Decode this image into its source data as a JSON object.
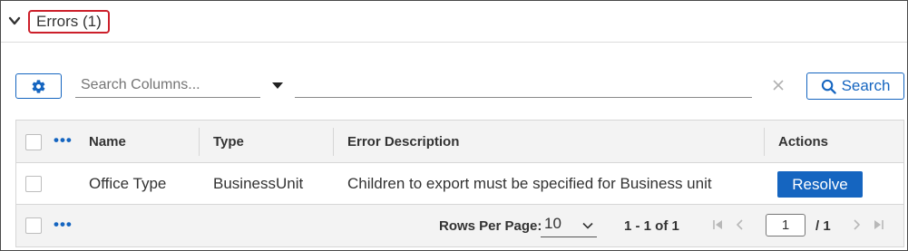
{
  "section": {
    "title": "Errors (1)",
    "expanded": true
  },
  "toolbar": {
    "settings_icon": "gear-icon",
    "search_columns_placeholder": "Search Columns...",
    "filter_value": "",
    "search_button_label": "Search",
    "search_icon": "search-icon"
  },
  "grid": {
    "columns": [
      "Name",
      "Type",
      "Error Description",
      "Actions"
    ],
    "rows": [
      {
        "name": "Office Type",
        "type": "BusinessUnit",
        "error_description": "Children to export must be specified for Business unit",
        "action_label": "Resolve"
      }
    ],
    "footer": {
      "rows_per_page_label": "Rows Per Page:",
      "rows_per_page_value": "10",
      "range_text": "1 - 1 of 1",
      "current_page": "1",
      "total_pages": "/ 1"
    }
  },
  "colors": {
    "accent": "#1565c0",
    "highlight_border": "#cc1f2a",
    "header_bg": "#f3f3f3"
  }
}
